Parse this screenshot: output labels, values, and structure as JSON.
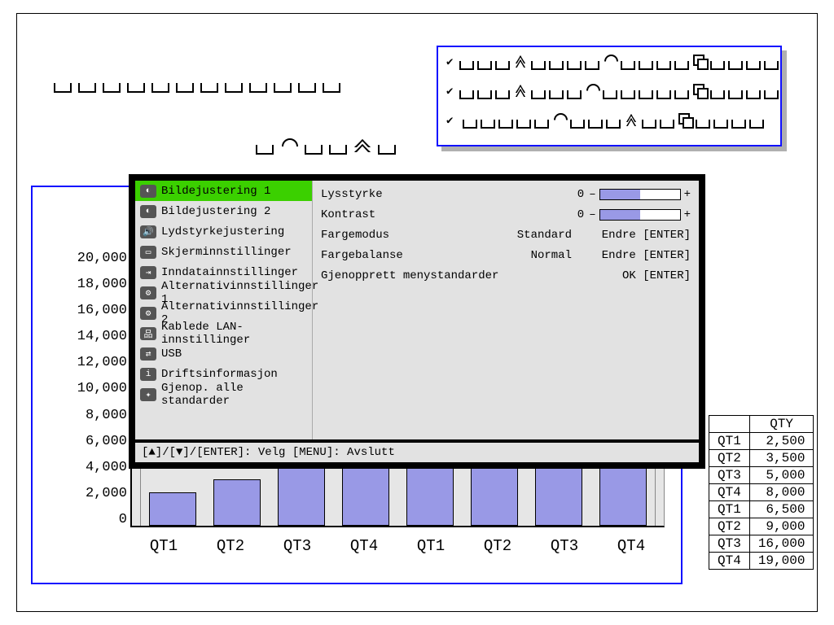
{
  "crumbs": {
    "rows": [
      {
        "checked": true
      },
      {
        "checked": true
      },
      {
        "checked": true
      }
    ]
  },
  "chart_data": {
    "type": "bar",
    "title": "",
    "xlabel": "",
    "ylabel": "",
    "ylim": [
      0,
      20000
    ],
    "yticks": [
      0,
      2000,
      4000,
      6000,
      8000,
      10000,
      12000,
      14000,
      16000,
      18000,
      20000
    ],
    "categories": [
      "QT1",
      "QT2",
      "QT3",
      "QT4",
      "QT1",
      "QT2",
      "QT3",
      "QT4"
    ],
    "values": [
      2500,
      3500,
      5000,
      8000,
      6500,
      9000,
      16000,
      19000
    ]
  },
  "qty_table": {
    "header": "QTY",
    "rows": [
      {
        "label": "QT1",
        "value": "2,500"
      },
      {
        "label": "QT2",
        "value": "3,500"
      },
      {
        "label": "QT3",
        "value": "5,000"
      },
      {
        "label": "QT4",
        "value": "8,000"
      },
      {
        "label": "QT1",
        "value": "6,500"
      },
      {
        "label": "QT2",
        "value": "9,000"
      },
      {
        "label": "QT3",
        "value": "16,000"
      },
      {
        "label": "QT4",
        "value": "19,000"
      }
    ]
  },
  "osd": {
    "left": [
      "Bildejustering 1",
      "Bildejustering 2",
      "Lydstyrkejustering",
      "Skjerminnstillinger",
      "Inndatainnstillinger",
      "Alternativinnstillinger 1",
      "Alternativinnstillinger 2",
      "Kablede LAN-innstillinger",
      "USB",
      "Driftsinformasjon",
      "Gjenop. alle standarder"
    ],
    "selected_index": 0,
    "right": {
      "brightness_label": "Lysstyrke",
      "brightness_value": "0",
      "contrast_label": "Kontrast",
      "contrast_value": "0",
      "colormode_label": "Fargemodus",
      "colormode_value": "Standard",
      "colormode_action": "Endre [ENTER]",
      "colorbalance_label": "Fargebalanse",
      "colorbalance_value": "Normal",
      "colorbalance_action": "Endre [ENTER]",
      "restore_label": "Gjenopprett menystandarder",
      "restore_action": "OK [ENTER]"
    },
    "footer": "[▲]/[▼]/[ENTER]: Velg  [MENU]: Avslutt"
  },
  "yaxis_labels": [
    "20,000",
    "18,000",
    "16,000",
    "14,000",
    "12,000",
    "10,000",
    "8,000",
    "6,000",
    "4,000",
    "2,000",
    "0"
  ]
}
